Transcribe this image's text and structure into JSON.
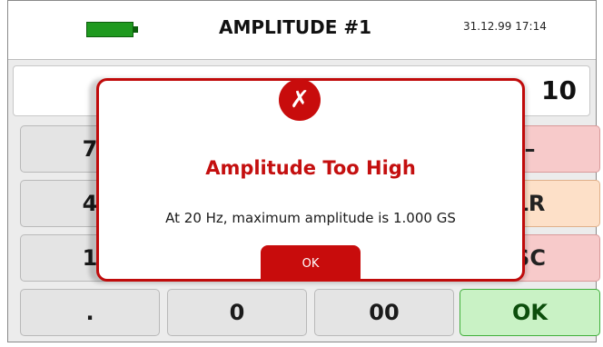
{
  "header": {
    "title": "AMPLITUDE #1",
    "datetime": "31.12.99 17:14"
  },
  "display": {
    "value": "10"
  },
  "keypad": {
    "row1": {
      "left": "7",
      "right": "–"
    },
    "row2": {
      "left": "4",
      "right": "LR"
    },
    "row3": {
      "left": "1",
      "right": "SC"
    },
    "row4": {
      "dot": ".",
      "zero": "0",
      "double_zero": "00",
      "ok": "OK"
    }
  },
  "dialog": {
    "icon_glyph": "✗",
    "title": "Amplitude Too High",
    "message": "At 20 Hz, maximum amplitude is 1.000 GS",
    "ok_label": "OK"
  },
  "colors": {
    "battery": "#1f9a1f",
    "error": "#c80c0c",
    "ok_key": "#c9f2c5"
  }
}
